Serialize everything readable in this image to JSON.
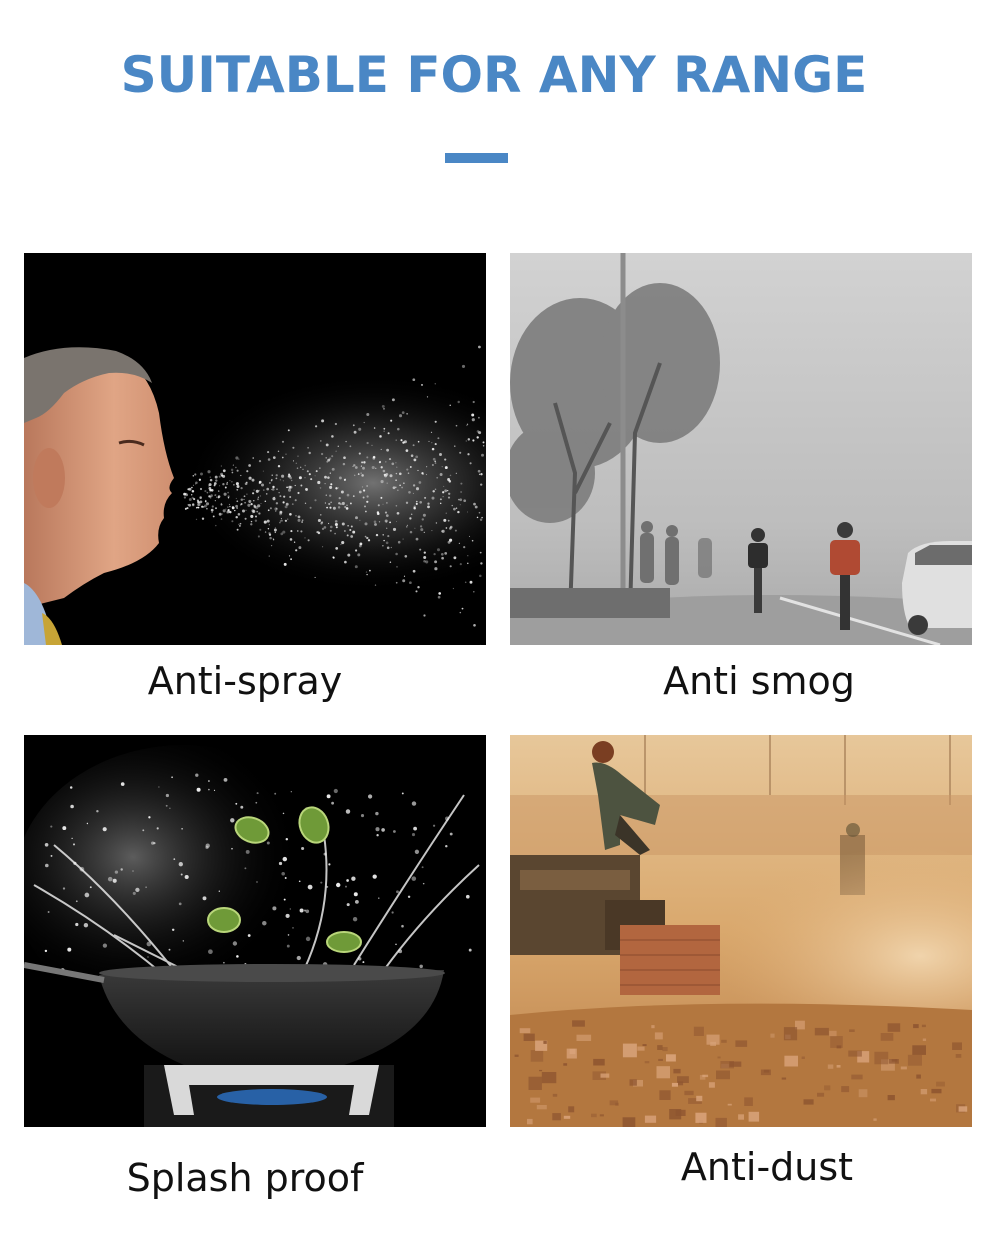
{
  "header": {
    "title": "SUITABLE FOR ANY RANGE",
    "accent_color": "#4a87c5"
  },
  "tiles": [
    {
      "caption": "Anti-spray",
      "image": "man-sneezing-spray-photo"
    },
    {
      "caption": "Anti smog",
      "image": "foggy-street-cyclists-photo"
    },
    {
      "caption": "Splash proof",
      "image": "wok-water-splash-photo"
    },
    {
      "caption": "Anti-dust",
      "image": "dusty-construction-site-photo"
    }
  ]
}
